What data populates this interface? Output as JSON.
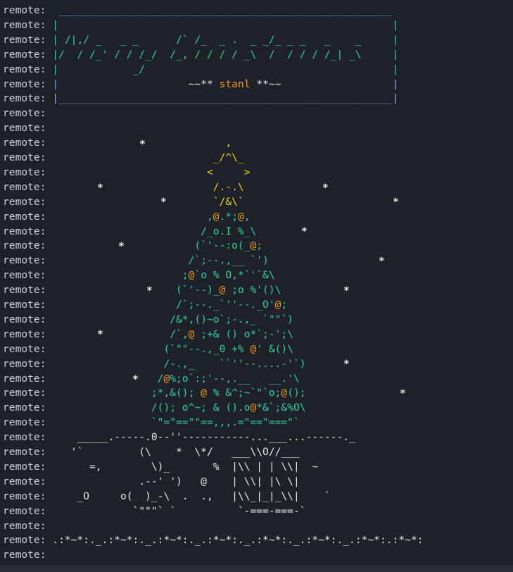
{
  "terminal": {
    "prefix": "remote:",
    "lines": [
      "  ______________________________________________________",
      " |                                                      |",
      " | /|,/ _   _ _      /` /_  _ .  _ _/_ _ _   _    _     |",
      " |/  / /_' / / /_/  /_, / / / / _\\  /  / / / /_| _\\     |",
      " |            _/                                        |",
      " |                     ~~** stanl **~~                  |",
      " |______________________________________________________|",
      "",
      "",
      "                             ,",
      "                           _/^\\_",
      "                          <     >",
      "                           /.-.\\",
      "                           `/&\\`",
      "                          ,@.*;@,",
      "                         /_o.I %_\\",
      "                        (`'--:o(_@;",
      "                       /`;--.,__ `')",
      "                      ;@`o % O,*`'`&\\",
      "                     (`'--)_@ ;o %'()\\",
      "                     /`;--._`''--._O'@;",
      "                    /&*,()~o`;-.,_ `\"\"`)",
      "                    /`,@ ;+& () o*`;-';\\",
      "                   (`\"\"--.,_0 +% @' &()\\",
      "                   /-.,_    ``''--....-'`)",
      "                  /@%;o`:;'--,.__   __.'\\",
      "                 ;*,&(); @ % &^;~`\"`o;@();",
      "                 /(); o^~; & ().o@*&`;&%O\\",
      "                 `\"=\"==\"\"==,,,.=\"==\"===\"`",
      "     _____.-----.0--''-----------...___...------._",
      "    '`         (\\    *  \\*/   ___\\\\O//___",
      "       =,        \\)_       %  |\\\\ | | \\\\|  ~",
      "               .--' ')   @    | \\\\| |\\ \\|",
      "     _O     o(  )_-\\  .  .,   |\\\\_|_|_\\\\|    `",
      "              `\"\"\"` `          `-===-===-`",
      "",
      " .:*~*:._.:*~*:._.:*~*:._.:*~*:._.:*~*:._.:*~*:._.:*~*:.:*~*:",
      ""
    ],
    "title_text": "~~** stanl **~~",
    "snowflakes": "*"
  },
  "colors": {
    "background": "#1e2127",
    "prefix": "#ced3da",
    "box_top": "#5fa8e8",
    "box_bottom": "#a99ee6",
    "tree": "#2bd4a8",
    "star": "#f1d60b",
    "ornament_orange": "#f39c12",
    "ornament_red": "#e33a3a",
    "snow": "#e6e6e6"
  }
}
